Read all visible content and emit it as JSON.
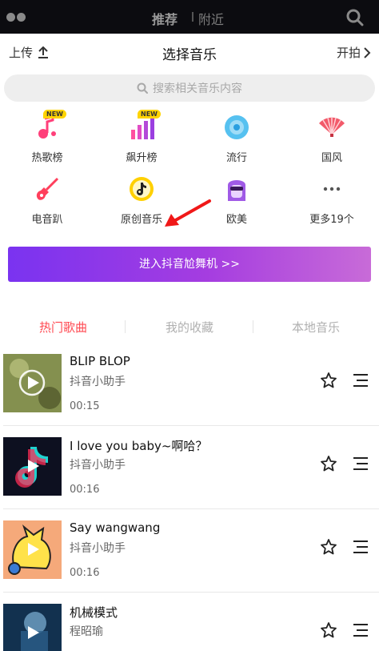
{
  "topbar": {
    "tab_recommend": "推荐",
    "tab_nearby": "附近"
  },
  "header": {
    "upload_label": "上传",
    "title": "选择音乐",
    "start_label": "开拍"
  },
  "search": {
    "placeholder": "搜索相关音乐内容"
  },
  "categories": [
    {
      "label": "热歌榜",
      "icon": "music-note-icon",
      "badge": "NEW"
    },
    {
      "label": "飙升榜",
      "icon": "chart-bars-icon",
      "badge": "NEW"
    },
    {
      "label": "流行",
      "icon": "vinyl-disc-icon"
    },
    {
      "label": "国风",
      "icon": "folding-fan-icon"
    },
    {
      "label": "电音趴",
      "icon": "electric-guitar-icon"
    },
    {
      "label": "原创音乐",
      "icon": "tiktok-note-icon"
    },
    {
      "label": "欧美",
      "icon": "sunglasses-face-icon"
    },
    {
      "label": "更多19个",
      "icon": "more-dots-icon"
    }
  ],
  "banner": {
    "label": "进入抖音尬舞机 >>"
  },
  "tabs": [
    "热门歌曲",
    "我的收藏",
    "本地音乐"
  ],
  "songs": [
    {
      "title": "BLIP BLOP",
      "artist": "抖音小助手",
      "duration": "00:15"
    },
    {
      "title": "I love you baby~啊哈？",
      "artist": "抖音小助手",
      "duration": "00:16"
    },
    {
      "title": "Say wangwang",
      "artist": "抖音小助手",
      "duration": "00:16"
    },
    {
      "title": "机械模式",
      "artist": "程昭瑜",
      "duration": ""
    }
  ],
  "colors": {
    "accent": "#ff4a52",
    "banner_start": "#7a33f0",
    "banner_end": "#c86bd8",
    "badge": "#ffd400"
  }
}
